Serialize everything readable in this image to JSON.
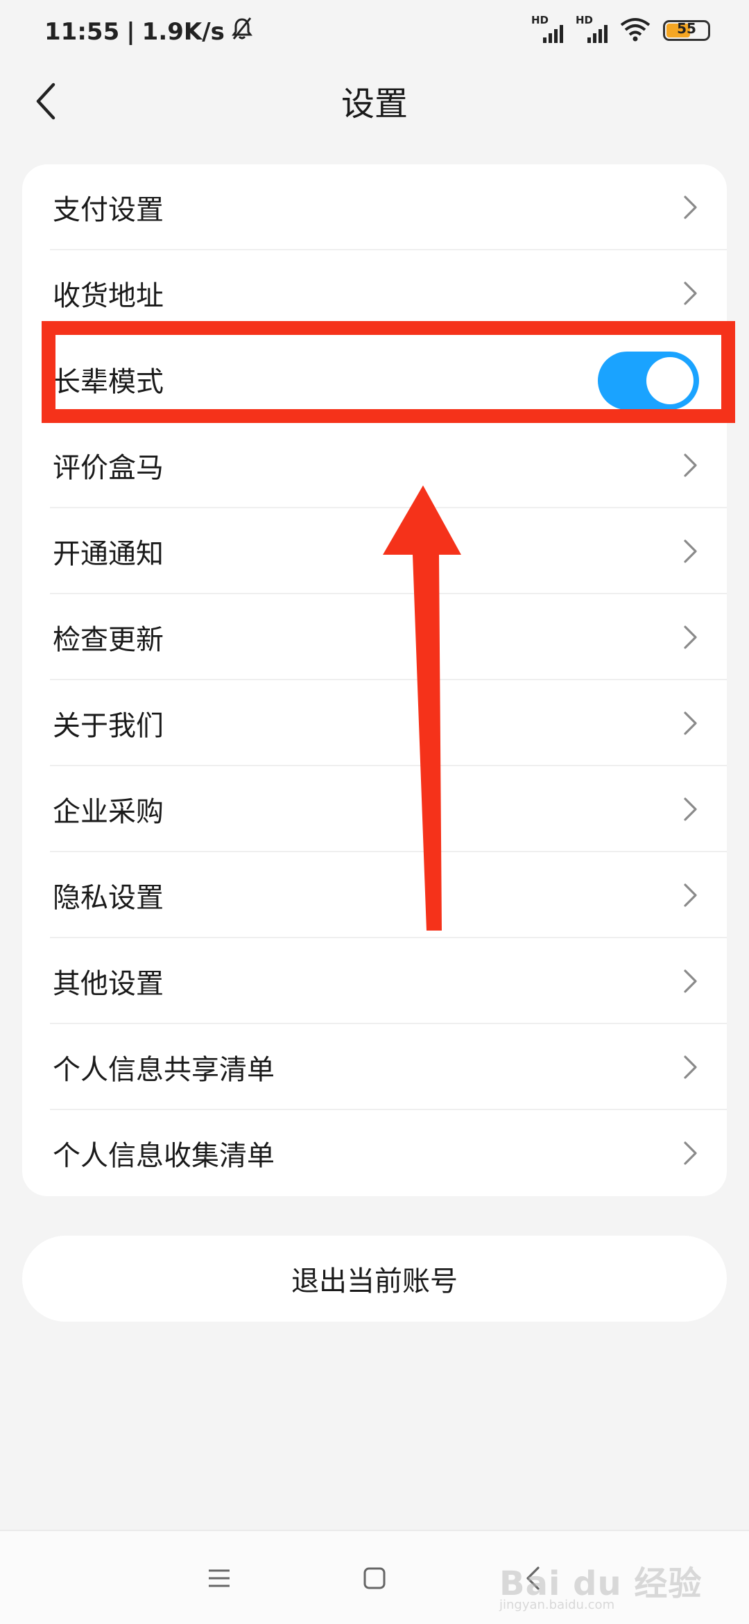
{
  "status_bar": {
    "time": "11:55",
    "network_speed": "1.9K/s",
    "battery": "55",
    "signal_label": "HD",
    "icons": [
      "bell-off-icon",
      "signal-icon",
      "signal-icon",
      "wifi-icon",
      "battery-icon"
    ]
  },
  "header": {
    "title": "设置",
    "back_icon": "chevron-left-icon"
  },
  "settings": {
    "items": [
      {
        "label": "支付设置",
        "control": "chevron"
      },
      {
        "label": "收货地址",
        "control": "chevron"
      },
      {
        "label": "长辈模式",
        "control": "toggle",
        "toggle_on": true
      },
      {
        "label": "评价盒马",
        "control": "chevron"
      },
      {
        "label": "开通通知",
        "control": "chevron"
      },
      {
        "label": "检查更新",
        "control": "chevron"
      },
      {
        "label": "关于我们",
        "control": "chevron"
      },
      {
        "label": "企业采购",
        "control": "chevron"
      },
      {
        "label": "隐私设置",
        "control": "chevron"
      },
      {
        "label": "其他设置",
        "control": "chevron"
      },
      {
        "label": "个人信息共享清单",
        "control": "chevron"
      },
      {
        "label": "个人信息收集清单",
        "control": "chevron"
      }
    ]
  },
  "logout": {
    "label": "退出当前账号"
  },
  "nav": {
    "icons": [
      "menu-icon",
      "home-icon",
      "back-icon"
    ]
  },
  "colors": {
    "toggle_on": "#1aa3ff",
    "annotation": "#f5321a",
    "battery_fill": "#f5a623",
    "background": "#f4f4f4"
  },
  "watermark": {
    "text": "Bai du 经验",
    "sub": "jingyan.baidu.com"
  }
}
